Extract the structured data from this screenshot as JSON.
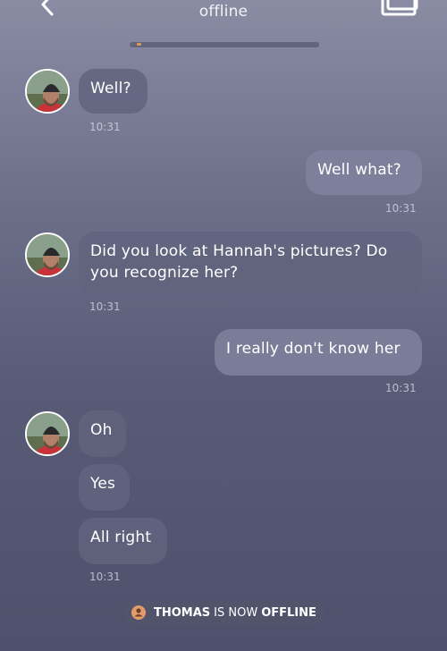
{
  "header": {
    "status": "offline",
    "back_icon": "chevron-left-icon",
    "gallery_icon": "gallery-icon"
  },
  "messages": [
    {
      "direction": "incoming",
      "text": "Well?",
      "time": "10:31"
    },
    {
      "direction": "outgoing",
      "text": "Well what?",
      "time": "10:31"
    },
    {
      "direction": "incoming",
      "text": "Did you look at Hannah's pictures? Do you recognize her?",
      "time": "10:31"
    },
    {
      "direction": "outgoing",
      "text": "I really don't know her",
      "time": "10:31"
    },
    {
      "direction": "incoming",
      "text": "Oh"
    },
    {
      "direction": "incoming",
      "text": "Yes"
    },
    {
      "direction": "incoming",
      "text": "All right",
      "time": "10:31"
    }
  ],
  "status_notice": {
    "name": "THOMAS",
    "middle": "IS NOW",
    "state": "OFFLINE",
    "icon": "user-icon"
  },
  "colors": {
    "incoming_bubble": "#62647e",
    "outgoing_bubble": "#80839e",
    "notice_icon": "#e59a6a"
  }
}
